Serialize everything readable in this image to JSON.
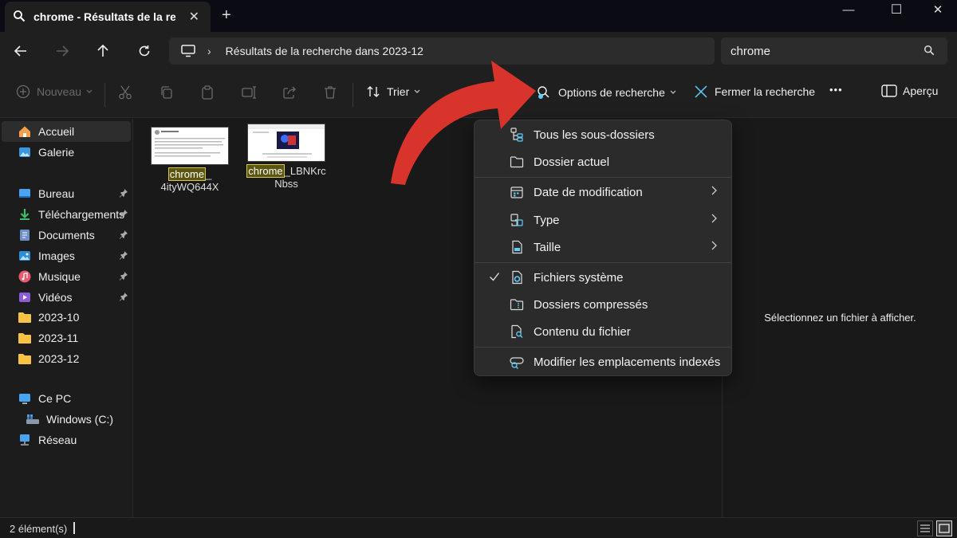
{
  "window": {
    "tab_title": "chrome - Résultats de la reche",
    "new_tab": "+",
    "minimize": "—",
    "maximize": "☐",
    "close": "✕"
  },
  "address": {
    "path": "Résultats de la recherche dans 2023-12",
    "separator": "›"
  },
  "search": {
    "value": "chrome"
  },
  "toolbar": {
    "new_label": "Nouveau",
    "sort_label": "Trier",
    "search_options_label": "Options de recherche",
    "close_search_label": "Fermer la recherche",
    "more": "•••",
    "preview_label": "Aperçu"
  },
  "sidebar": {
    "items": [
      {
        "label": "Accueil",
        "icon": "home-icon"
      },
      {
        "label": "Galerie",
        "icon": "gallery-icon"
      },
      {
        "label": "Bureau",
        "icon": "desktop-icon"
      },
      {
        "label": "Téléchargements",
        "icon": "download-icon"
      },
      {
        "label": "Documents",
        "icon": "documents-icon"
      },
      {
        "label": "Images",
        "icon": "images-icon"
      },
      {
        "label": "Musique",
        "icon": "music-icon"
      },
      {
        "label": "Vidéos",
        "icon": "videos-icon"
      },
      {
        "label": "2023-10",
        "icon": "folder-icon"
      },
      {
        "label": "2023-11",
        "icon": "folder-icon"
      },
      {
        "label": "2023-12",
        "icon": "folder-icon"
      },
      {
        "label": "Ce PC",
        "icon": "pc-icon"
      },
      {
        "label": "Windows (C:)",
        "icon": "drive-icon"
      },
      {
        "label": "Réseau",
        "icon": "network-icon"
      }
    ]
  },
  "files": [
    {
      "highlight": "chrome",
      "rest1": "_",
      "line2": "4ityWQ644X"
    },
    {
      "highlight": "chrome",
      "rest1": "_LBNKrc",
      "line2": "Nbss"
    }
  ],
  "menu": {
    "items": [
      {
        "label": "Tous les sous-dossiers",
        "icon": "subfolders-icon"
      },
      {
        "label": "Dossier actuel",
        "icon": "folder-outline-icon"
      },
      {
        "label": "Date de modification",
        "icon": "calendar-icon",
        "submenu": true
      },
      {
        "label": "Type",
        "icon": "type-icon",
        "submenu": true
      },
      {
        "label": "Taille",
        "icon": "size-icon",
        "submenu": true
      },
      {
        "label": "Fichiers système",
        "icon": "system-file-icon",
        "checked": true
      },
      {
        "label": "Dossiers compressés",
        "icon": "zip-folder-icon"
      },
      {
        "label": "Contenu du fichier",
        "icon": "file-content-icon"
      },
      {
        "label": "Modifier les emplacements indexés",
        "icon": "index-locations-icon"
      }
    ],
    "check_mark": "✓"
  },
  "preview": {
    "empty_text": "Sélectionnez un fichier à afficher."
  },
  "status": {
    "count": "2 élément(s)"
  },
  "colors": {
    "accent": "#60cdff",
    "arrow": "#d9342b",
    "highlight_bg": "#5b5510",
    "highlight_border": "#d4c94a",
    "folder": "#f6c344"
  }
}
